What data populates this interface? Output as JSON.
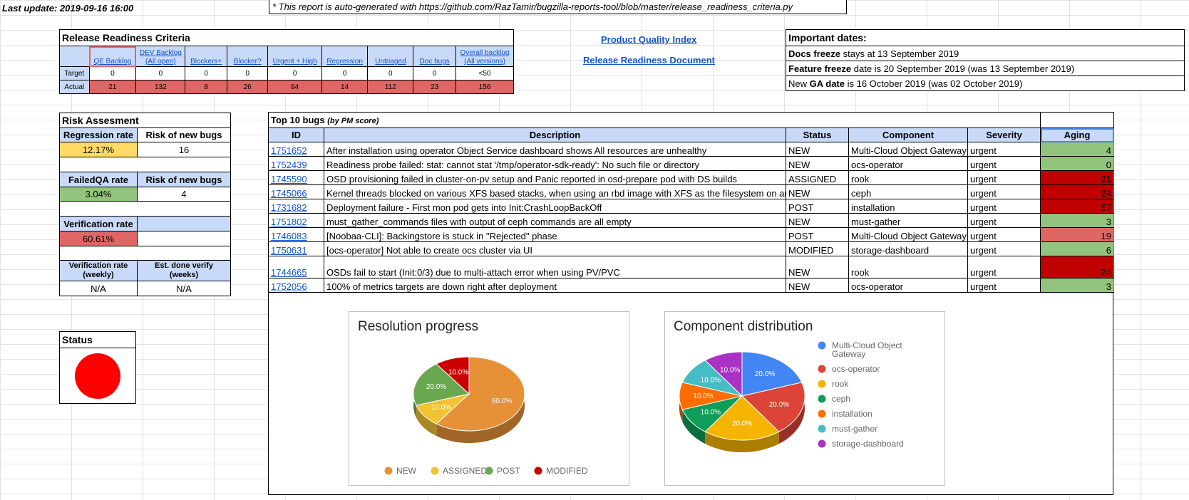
{
  "last_update": "Last update: 2019-09-16 16:00",
  "auto_note": "* This report is auto-generated with https://github.com/RazTamir/bugzilla-reports-tool/blob/master/release_readiness_criteria.py",
  "links": {
    "pqi": "Product Quality Index",
    "rrd": "Release Readiness Document"
  },
  "rrc": {
    "title": "Release Readiness Criteria",
    "columns": [
      "QE Backlog",
      "DEV Backlog (All open)",
      "Blockers+",
      "Blocker?",
      "Urgent + High",
      "Regression",
      "Untriaged",
      "Doc bugs",
      "Overall backlog (All versions)"
    ],
    "col_lines": [
      [
        "QE Backlog"
      ],
      [
        "DEV Backlog",
        "(All open)"
      ],
      [
        "Blockers+"
      ],
      [
        "Blocker?"
      ],
      [
        "Urgent + High"
      ],
      [
        "Regression"
      ],
      [
        "Untriaged"
      ],
      [
        "Doc bugs"
      ],
      [
        "Overall backlog",
        "(All versions)"
      ]
    ],
    "target_label": "Target",
    "actual_label": "Actual",
    "target": [
      "0",
      "0",
      "0",
      "0",
      "0",
      "0",
      "0",
      "0",
      "<50"
    ],
    "actual": [
      "21",
      "132",
      "8",
      "26",
      "94",
      "14",
      "112",
      "23",
      "156"
    ]
  },
  "dates": {
    "title": "Important dates:",
    "lines": [
      {
        "pre": "",
        "bold": "Docs freeze",
        "post": " stays at 13 September 2019"
      },
      {
        "pre": "",
        "bold": "Feature freeze",
        "post": " date is 20 September 2019 (was 13 September 2019)"
      },
      {
        "pre": "New ",
        "bold": "GA date",
        "post": " is 16 October 2019 (was 02 October 2019)"
      }
    ]
  },
  "risk": {
    "title": "Risk Assesment",
    "regression_rate_label": "Regression rate",
    "risk_new_bugs_label": "Risk of new bugs",
    "regression_rate": "12.17%",
    "regression_risk": "16",
    "failedqa_label": "FailedQA rate",
    "failedqa_rate": "3.04%",
    "failedqa_risk": "4",
    "verification_label": "Verification rate",
    "verification_rate": "60.61%",
    "weekly_label_1": "Verification rate",
    "weekly_label_2": "(weekly)",
    "est_label_1": "Est. done verify",
    "est_label_2": "(weeks)",
    "weekly_value": "N/A",
    "est_value": "N/A"
  },
  "status": {
    "title": "Status",
    "color": "#ff0000"
  },
  "bugs": {
    "title": "Top 10 bugs",
    "subtitle": "(by PM score)",
    "headers": [
      "ID",
      "Description",
      "Status",
      "Component",
      "Severity",
      "Aging"
    ],
    "rows": [
      {
        "id": "1751652",
        "desc": "After installation using operator Object Service dashboard shows All resources are unhealthy",
        "status": "NEW",
        "component": "Multi-Cloud Object Gateway",
        "severity": "urgent",
        "aging": "4",
        "color": "#93c47d"
      },
      {
        "id": "1752439",
        "desc": "Readiness probe failed: stat: cannot stat '/tmp/operator-sdk-ready': No such file or directory",
        "status": "NEW",
        "component": "ocs-operator",
        "severity": "urgent",
        "aging": "0",
        "color": "#93c47d"
      },
      {
        "id": "1745590",
        "desc": "OSD provisioning failed in cluster-on-pv setup and Panic reported in osd-prepare pod with DS builds",
        "status": "ASSIGNED",
        "component": "rook",
        "severity": "urgent",
        "aging": "21",
        "color": "#c00000"
      },
      {
        "id": "1745066",
        "desc": "Kernel threads blocked on various XFS based stacks, when using an rbd image with XFS as the filesystem on an",
        "status": "NEW",
        "component": "ceph",
        "severity": "urgent",
        "aging": "24",
        "color": "#c00000"
      },
      {
        "id": "1731682",
        "desc": "Deployment failure - First mon pod gets into Init:CrashLoopBackOff",
        "status": "POST",
        "component": "installation",
        "severity": "urgent",
        "aging": "57",
        "color": "#c00000"
      },
      {
        "id": "1751802",
        "desc": "must_gather_commands files with output of ceph commands are all empty",
        "status": "NEW",
        "component": "must-gather",
        "severity": "urgent",
        "aging": "3",
        "color": "#93c47d"
      },
      {
        "id": "1746083",
        "desc": "[Noobaa-CLI]: Backingstore is stuck in \"Rejected\" phase",
        "status": "POST",
        "component": "Multi-Cloud Object Gateway",
        "severity": "urgent",
        "aging": "19",
        "color": "#e06666"
      },
      {
        "id": "1750631",
        "desc": "[ocs-operator] Not able to create ocs cluster via UI",
        "status": "MODIFIED",
        "component": "storage-dashboard",
        "severity": "urgent",
        "aging": "6",
        "color": "#93c47d"
      },
      {
        "id": "1744665",
        "desc": "OSDs fail to start (Init:0/3) due to multi-attach error when using PV/PVC",
        "status": "NEW",
        "component": "rook",
        "severity": "urgent",
        "aging": "24",
        "color": "#c00000"
      },
      {
        "id": "1752056",
        "desc": "100% of metrics targets are down right after deployment",
        "status": "NEW",
        "component": "ocs-operator",
        "severity": "urgent",
        "aging": "3",
        "color": "#93c47d"
      }
    ]
  },
  "chart_data": [
    {
      "type": "pie",
      "title": "Resolution progress",
      "categories": [
        "NEW",
        "ASSIGNED",
        "POST",
        "MODIFIED"
      ],
      "values": [
        60,
        10,
        20,
        10
      ],
      "labels": [
        "60.0%",
        "10.0%",
        "20.0%",
        "10.0%"
      ],
      "colors": [
        "#e69138",
        "#f1c232",
        "#6aa84f",
        "#cc0000"
      ],
      "legend": "bottom"
    },
    {
      "type": "pie",
      "title": "Component distribution",
      "categories": [
        "Multi-Cloud Object Gateway",
        "ocs-operator",
        "rook",
        "ceph",
        "installation",
        "must-gather",
        "storage-dashboard"
      ],
      "values": [
        20,
        20,
        20,
        10,
        10,
        10,
        10
      ],
      "labels": [
        "20.0%",
        "20.0%",
        "20.0%",
        "10.0%",
        "10.0%",
        "10.0%",
        "10.0%"
      ],
      "colors": [
        "#4285f4",
        "#db4437",
        "#f4b400",
        "#0f9d58",
        "#ff6d00",
        "#46bdc6",
        "#ab30c4"
      ],
      "legend": "right"
    }
  ]
}
